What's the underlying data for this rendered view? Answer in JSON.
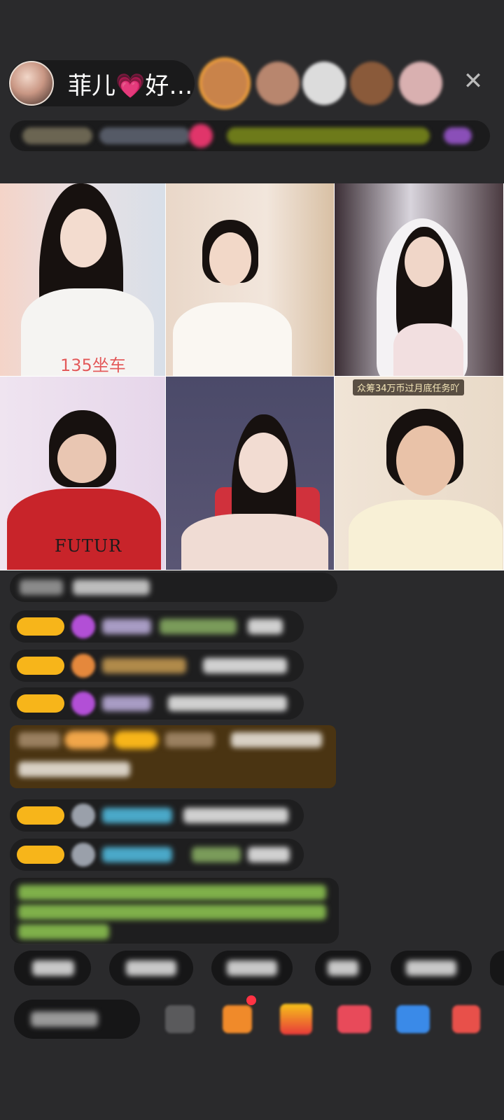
{
  "header": {
    "host_name": "菲儿💗好…",
    "close_icon": "close-icon"
  },
  "colors": {
    "background": "#2a2a2c",
    "badge_yellow": "#f7b51a",
    "tile_border": "#ffffff"
  },
  "video_grid": {
    "tiles": [
      {
        "overlay": "135坐车"
      },
      {
        "overlay": ""
      },
      {
        "overlay": ""
      },
      {
        "overlay": "",
        "shirt_text": "FUTUR"
      },
      {
        "overlay": ""
      },
      {
        "overlay": "众筹34万币过月底任务吖"
      }
    ]
  }
}
